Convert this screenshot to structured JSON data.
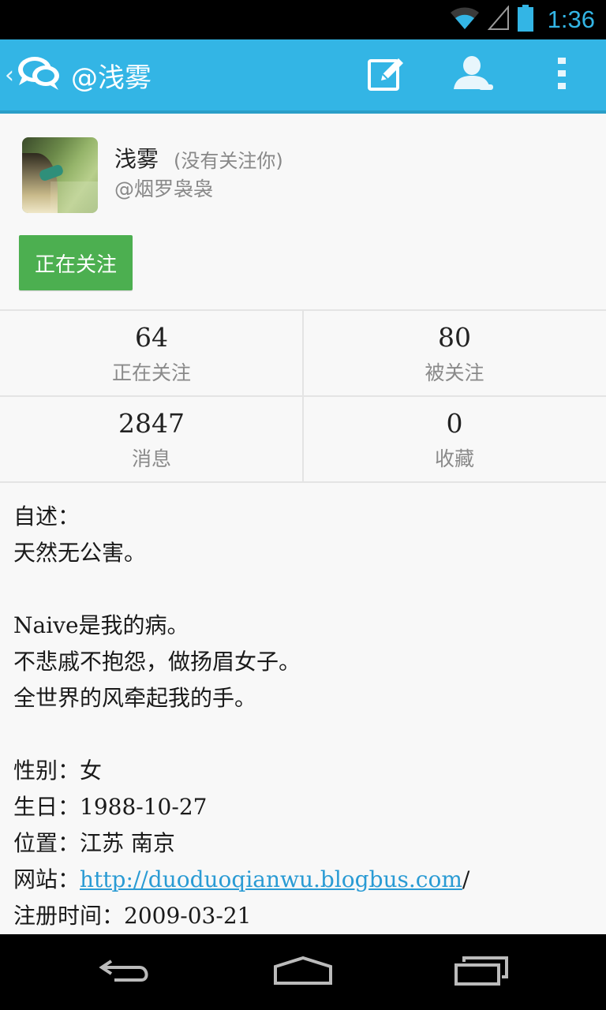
{
  "status_bar": {
    "time": "1:36"
  },
  "action_bar": {
    "title": "@浅雾"
  },
  "profile": {
    "name": "浅雾",
    "follow_status": "(没有关注你)",
    "handle": "@烟罗袅袅",
    "follow_button": "正在关注"
  },
  "stats": [
    {
      "value": "64",
      "label": "正在关注"
    },
    {
      "value": "80",
      "label": "被关注"
    },
    {
      "value": "2847",
      "label": "消息"
    },
    {
      "value": "0",
      "label": "收藏"
    }
  ],
  "bio": {
    "intro_label": "自述：",
    "lines": [
      "天然无公害。",
      "Naive是我的病。",
      "不悲戚不抱怨，做扬眉女子。",
      "全世界的风牵起我的手。"
    ],
    "gender_label": "性别：",
    "gender": "女",
    "birthday_label": "生日：",
    "birthday": "1988-10-27",
    "location_label": "位置：",
    "location": "江苏 南京",
    "website_label": "网站：",
    "website": "http://duoduoqianwu.blogbus.com",
    "website_suffix": "/",
    "registered_label": "注册时间：",
    "registered": "2009-03-21"
  },
  "colors": {
    "accent": "#33b5e5",
    "follow_button": "#4caf50",
    "link": "#2a9bd4"
  },
  "icons": [
    "wifi-icon",
    "cell-signal-icon",
    "battery-icon",
    "chat-bubbles-icon",
    "compose-icon",
    "user-icon",
    "overflow-menu-icon",
    "back-nav-icon",
    "home-nav-icon",
    "recents-nav-icon"
  ]
}
